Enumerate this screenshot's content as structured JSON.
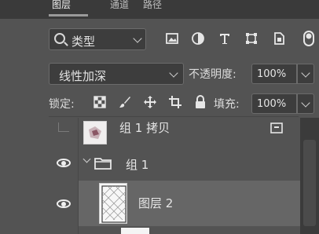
{
  "tabs": [
    {
      "label": "图层"
    },
    {
      "label": "通道"
    },
    {
      "label": "路径"
    }
  ],
  "filter": {
    "kind_label": "类型",
    "icons": [
      "image-filter-icon",
      "adjustment-filter-icon",
      "type-filter-icon",
      "shape-filter-icon",
      "smart-object-filter-icon",
      "filter-toggle-icon"
    ]
  },
  "blend": {
    "mode": "线性加深",
    "opacity_label": "不透明度:",
    "opacity_value": "100%"
  },
  "lock": {
    "label": "锁定:",
    "fill_label": "填充:",
    "fill_value": "100%"
  },
  "layers": [
    {
      "name": "组 1 拷贝",
      "visible": false,
      "type": "group-copy"
    },
    {
      "name": "组 1",
      "visible": true,
      "type": "group",
      "expanded": true
    },
    {
      "name": "图层 2",
      "visible": true,
      "type": "layer",
      "selected": true
    }
  ],
  "colors": {
    "panel_bg": "#535353",
    "field_bg": "#3d3d3d",
    "selected_row": "#666666",
    "text": "#e6e6e6"
  }
}
